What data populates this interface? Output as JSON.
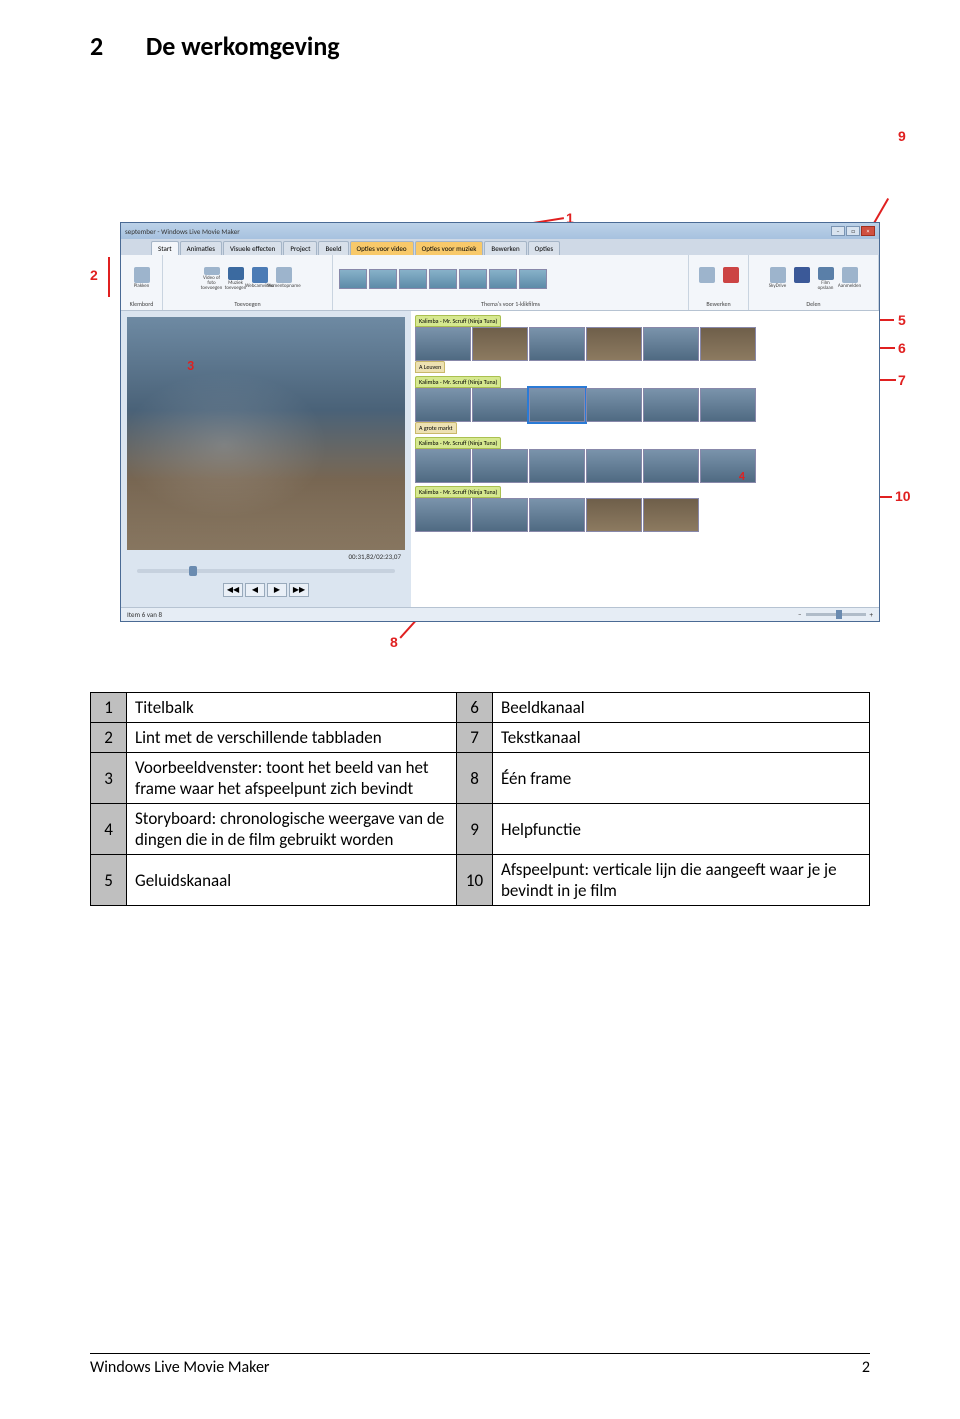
{
  "heading": {
    "number": "2",
    "title": "De werkomgeving"
  },
  "app": {
    "titlebar": "september    - Windows Live Movie Maker",
    "tabs": [
      "Start",
      "Animaties",
      "Visuele effecten",
      "Project",
      "Beeld",
      "Bewerken",
      "Opties"
    ],
    "context_tabs": [
      "Opties voor video",
      "Opties voor muziek"
    ],
    "ribbon_groups": {
      "klembord": {
        "label": "Klembord",
        "items": [
          "Plakken"
        ]
      },
      "toevoegen": {
        "label": "Toevoegen",
        "items": [
          "Video of foto toevoegen",
          "Muziek toevoegen",
          "Webcamvideo",
          "Momentopname"
        ]
      },
      "themas": {
        "label": "Thema's voor 1-klikfilms"
      },
      "bewerken": {
        "label": "Bewerken"
      },
      "delen": {
        "label": "Delen",
        "items": [
          "SkyDrive",
          "Film opslaan",
          "Aanmelden"
        ]
      }
    },
    "preview": {
      "timecode": "00:31,82/02:23,07"
    },
    "tracks": [
      {
        "music": "Kalimba - Mr. Scruff (Ninja Tuna)",
        "caption": "A Leuven"
      },
      {
        "music": "Kalimba - Mr. Scruff (Ninja Tuna)",
        "caption": "A grote markt"
      },
      {
        "music": "Kalimba - Mr. Scruff (Ninja Tuna)"
      },
      {
        "music": "Kalimba - Mr. Scruff (Ninja Tuna)"
      }
    ],
    "statusbar": "Item 6 van 8",
    "callouts": {
      "1": "1",
      "2": "2",
      "3": "3",
      "4": "4",
      "5": "5",
      "6": "6",
      "7": "7",
      "8": "8",
      "9": "9",
      "10": "10"
    }
  },
  "legend": {
    "rows": [
      {
        "ln": "1",
        "ld": "Titelbalk",
        "rn": "6",
        "rd": "Beeldkanaal"
      },
      {
        "ln": "2",
        "ld": "Lint met de verschillende tabbladen",
        "rn": "7",
        "rd": "Tekstkanaal"
      },
      {
        "ln": "3",
        "ld": "Voorbeeldvenster: toont het beeld van het frame waar het afspeelpunt zich bevindt",
        "rn": "8",
        "rd": "Één frame"
      },
      {
        "ln": "4",
        "ld": "Storyboard: chronologische weergave van de dingen die in de film gebruikt worden",
        "rn": "9",
        "rd": "Helpfunctie"
      },
      {
        "ln": "5",
        "ld": "Geluidskanaal",
        "rn": "10",
        "rd": "Afspeelpunt: verticale lijn die aangeeft waar je je bevindt in je film"
      }
    ]
  },
  "footer": {
    "left": "Windows Live Movie Maker",
    "right": "2"
  }
}
